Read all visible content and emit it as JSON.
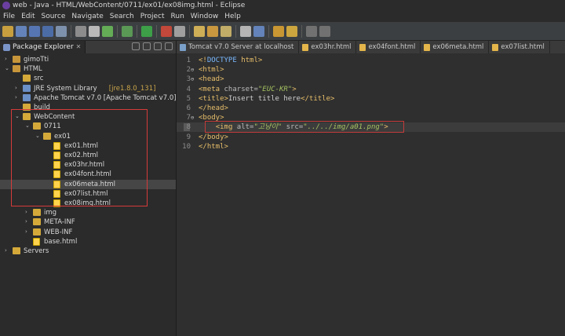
{
  "window": {
    "title": "web - Java - HTML/WebContent/0711/ex01/ex08img.html - Eclipse"
  },
  "menu": [
    "File",
    "Edit",
    "Source",
    "Navigate",
    "Search",
    "Project",
    "Run",
    "Window",
    "Help"
  ],
  "explorer": {
    "tab_label": "Package Explorer",
    "tree": [
      {
        "label": "gimoTti",
        "level": 0,
        "kind": "project",
        "arrow": "›"
      },
      {
        "label": "HTML",
        "level": 0,
        "kind": "project",
        "arrow": "⌄"
      },
      {
        "label": "src",
        "level": 1,
        "kind": "folder",
        "arrow": ""
      },
      {
        "label": "JRE System Library",
        "suffix": "[jre1.8.0_131]",
        "level": 1,
        "kind": "lib",
        "arrow": "›"
      },
      {
        "label": "Apache Tomcat v7.0 [Apache Tomcat v7.0]",
        "level": 1,
        "kind": "lib",
        "arrow": "›"
      },
      {
        "label": "build",
        "level": 1,
        "kind": "folder",
        "arrow": ""
      },
      {
        "label": "WebContent",
        "level": 1,
        "kind": "folder",
        "arrow": "⌄"
      },
      {
        "label": "0711",
        "level": 2,
        "kind": "folder",
        "arrow": "⌄"
      },
      {
        "label": "ex01",
        "level": 3,
        "kind": "folder",
        "arrow": "⌄"
      },
      {
        "label": "ex01.html",
        "level": 4,
        "kind": "file",
        "arrow": ""
      },
      {
        "label": "ex02.html",
        "level": 4,
        "kind": "file",
        "arrow": ""
      },
      {
        "label": "ex03hr.html",
        "level": 4,
        "kind": "file",
        "arrow": ""
      },
      {
        "label": "ex04font.html",
        "level": 4,
        "kind": "file",
        "arrow": ""
      },
      {
        "label": "ex06meta.html",
        "level": 4,
        "kind": "file",
        "arrow": "",
        "selected": true
      },
      {
        "label": "ex07list.html",
        "level": 4,
        "kind": "file",
        "arrow": ""
      },
      {
        "label": "ex08img.html",
        "level": 4,
        "kind": "file",
        "arrow": ""
      },
      {
        "label": "img",
        "level": 2,
        "kind": "folder",
        "arrow": "›"
      },
      {
        "label": "META-INF",
        "level": 2,
        "kind": "folder",
        "arrow": "›"
      },
      {
        "label": "WEB-INF",
        "level": 2,
        "kind": "folder",
        "arrow": "›"
      },
      {
        "label": "base.html",
        "level": 2,
        "kind": "file",
        "arrow": ""
      },
      {
        "label": "Servers",
        "level": 0,
        "kind": "folder",
        "arrow": "›"
      }
    ]
  },
  "editor": {
    "tabs": [
      "Tomcat v7.0 Server at localhost",
      "ex03hr.html",
      "ex04font.html",
      "ex06meta.html",
      "ex07list.html"
    ],
    "lines": [
      {
        "n": "1",
        "fold": "",
        "parts": [
          [
            "t",
            "<!"
          ],
          [
            "d",
            "DOCTYPE"
          ],
          [
            "t",
            " html"
          ],
          [
            "t",
            ">"
          ]
        ]
      },
      {
        "n": "2",
        "fold": "⊖",
        "parts": [
          [
            "t",
            "<html>"
          ]
        ]
      },
      {
        "n": "3",
        "fold": "⊖",
        "parts": [
          [
            "t",
            "<head>"
          ]
        ]
      },
      {
        "n": "4",
        "fold": "",
        "parts": [
          [
            "t",
            "<meta "
          ],
          [
            "a",
            "charset="
          ],
          [
            "v",
            "\"EUC-KR\""
          ],
          [
            "t",
            ">"
          ]
        ]
      },
      {
        "n": "5",
        "fold": "",
        "parts": [
          [
            "t",
            "<title>"
          ],
          [
            "b",
            "Insert title here"
          ],
          [
            "t",
            "</title>"
          ]
        ]
      },
      {
        "n": "6",
        "fold": "",
        "parts": [
          [
            "t",
            "</head>"
          ]
        ]
      },
      {
        "n": "7",
        "fold": "⊖",
        "parts": [
          [
            "t",
            "<body>"
          ]
        ]
      },
      {
        "n": "8",
        "fold": "",
        "parts": [
          [
            "b",
            "    "
          ],
          [
            "t",
            "<img "
          ],
          [
            "a",
            "alt="
          ],
          [
            "v",
            "\"고냥이\""
          ],
          [
            "a",
            " src="
          ],
          [
            "v",
            "\"../../img/a01.png\""
          ],
          [
            "t",
            ">"
          ]
        ]
      },
      {
        "n": "9",
        "fold": "",
        "parts": [
          [
            "t",
            "</body>"
          ]
        ]
      },
      {
        "n": "10",
        "fold": "",
        "parts": [
          [
            "t",
            "</html>"
          ]
        ]
      }
    ]
  }
}
